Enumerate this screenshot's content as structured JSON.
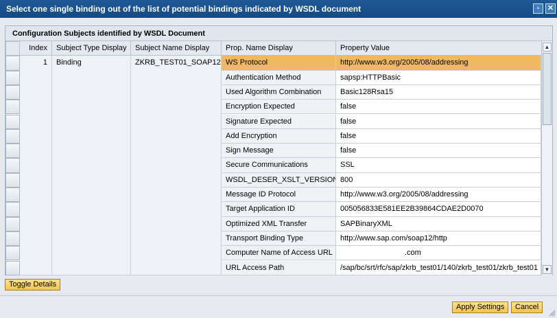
{
  "window": {
    "title": "Select one single binding out of the list of potential bindings indicated by WSDL document",
    "minimize_icon": "window-icon",
    "close_icon": "close-icon"
  },
  "panel": {
    "title": "Configuration Subjects identified by WSDL Document"
  },
  "table": {
    "columns": [
      "Index",
      "Subject Type Display",
      "Subject Name Display",
      "Prop. Name Display",
      "Property Value"
    ],
    "subject": {
      "index": "1",
      "type": "Binding",
      "name": "ZKRB_TEST01_SOAP12"
    },
    "rows": [
      {
        "prop": "WS Protocol",
        "value": "http://www.w3.org/2005/08/addressing"
      },
      {
        "prop": "Authentication Method",
        "value": "sapsp:HTTPBasic"
      },
      {
        "prop": "Used Algorithm Combination",
        "value": "Basic128Rsa15"
      },
      {
        "prop": "Encryption Expected",
        "value": "false"
      },
      {
        "prop": "Signature Expected",
        "value": "false"
      },
      {
        "prop": "Add Encryption",
        "value": "false"
      },
      {
        "prop": "Sign Message",
        "value": "false"
      },
      {
        "prop": "Secure Communications",
        "value": "SSL"
      },
      {
        "prop": "WSDL_DESER_XSLT_VERSION",
        "value": "800"
      },
      {
        "prop": "Message ID Protocol",
        "value": "http://www.w3.org/2005/08/addressing"
      },
      {
        "prop": "Target Application ID",
        "value": "005056833E581EE2B39864CDAE2D0070"
      },
      {
        "prop": "Optimized XML Transfer",
        "value": "SAPBinaryXML"
      },
      {
        "prop": "Transport Binding Type",
        "value": "http://www.sap.com/soap12/http"
      },
      {
        "prop": "Computer Name of Access URL",
        "value": ".com"
      },
      {
        "prop": "URL Access Path",
        "value": "/sap/bc/srt/rfc/sap/zkrb_test01/140/zkrb_test01/zkrb_test01"
      }
    ],
    "selected_row": 0,
    "highlight_color": "#f0b865"
  },
  "buttons": {
    "toggle_details": "Toggle Details",
    "apply_settings": "Apply Settings",
    "cancel": "Cancel"
  }
}
